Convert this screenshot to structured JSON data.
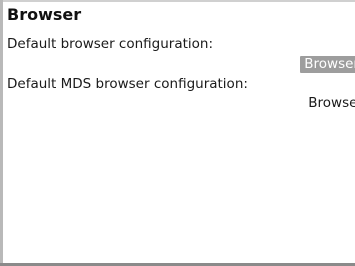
{
  "screen": {
    "title": "Browser",
    "fields": [
      {
        "label": "Default browser configuration:",
        "value": "Browser"
      },
      {
        "label": "Default MDS browser configuration:",
        "value": "Browser"
      }
    ]
  },
  "colors": {
    "background": "#ffffff",
    "text": "#1a1a1a",
    "selection": "#9d9d9d"
  }
}
